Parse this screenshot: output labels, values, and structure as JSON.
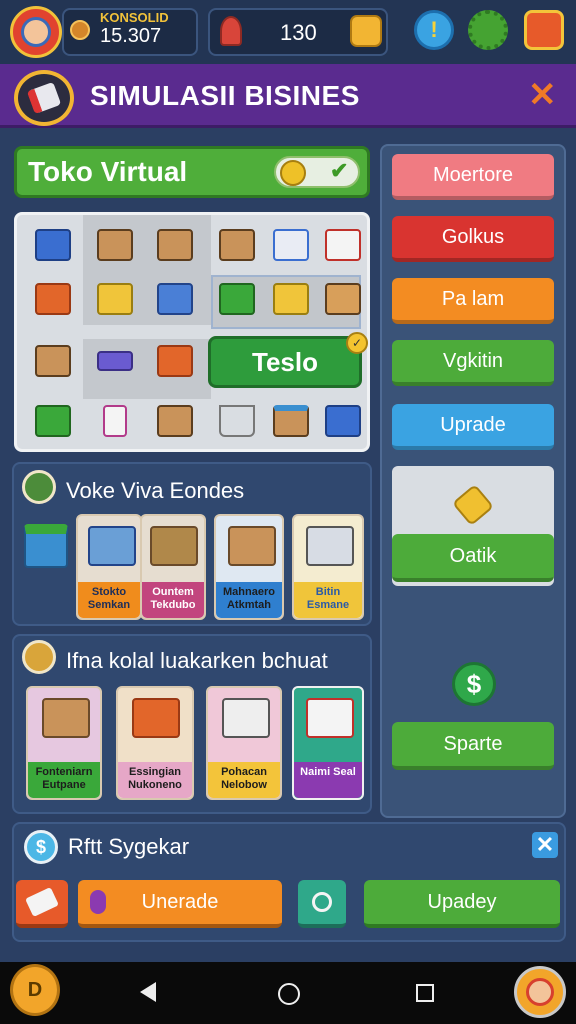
{
  "topbar": {
    "coin_label": "KONSOLID",
    "coin_value": "15.307",
    "gem_value": "130",
    "info_icon": "!",
    "gear_icon": "gear-icon",
    "exit_icon": "exit-icon"
  },
  "header": {
    "title": "SIMULASII BISINES",
    "close": "✕"
  },
  "store": {
    "name": "Toko Virtual",
    "action_label": "Teslo",
    "badge": "✓"
  },
  "section1": {
    "title": "Voke Viva Eondes",
    "cards": [
      {
        "label": "Stokto Semkan",
        "bg": "#f08c1c"
      },
      {
        "label": "Ountem Tekdubo",
        "bg": "#c2457e"
      },
      {
        "label": "Mahnaero Atkmtah",
        "bg": "#2f7fcf"
      },
      {
        "label": "Bitin Esmane",
        "bg": "#f0c53a"
      }
    ]
  },
  "section2": {
    "title": "Ifna kolal luakarken bchuat",
    "cards": [
      {
        "label": "Fonteniarn Eutpane",
        "bg": "#3aa83a"
      },
      {
        "label": "Essingian Nukoneno",
        "bg": "#e6a7c7"
      },
      {
        "label": "Pohacan Nelobow",
        "bg": "#f3c43a"
      },
      {
        "label": "Naimi Seal",
        "bg": "#8b3ab0"
      }
    ]
  },
  "sidebar": {
    "buttons": [
      {
        "label": "Moertore",
        "bg": "#f07b82"
      },
      {
        "label": "Golkus",
        "bg": "#d93430"
      },
      {
        "label": "Pa lam",
        "bg": "#f38c22"
      },
      {
        "label": "Vgkitin",
        "bg": "#4dab3a"
      },
      {
        "label": "Uprade",
        "bg": "#3aa3e2"
      }
    ],
    "oatik": "Oatik",
    "dollar": "$",
    "sparte": "Sparte"
  },
  "bottom": {
    "title": "Rftt Sygekar",
    "unerade": "Unerade",
    "upadey": "Upadey"
  },
  "nav": {
    "left_label": "D"
  },
  "colors": {
    "purple_header": "#5a2b8f",
    "accent_orange": "#f07a27",
    "green": "#4fae3a"
  }
}
